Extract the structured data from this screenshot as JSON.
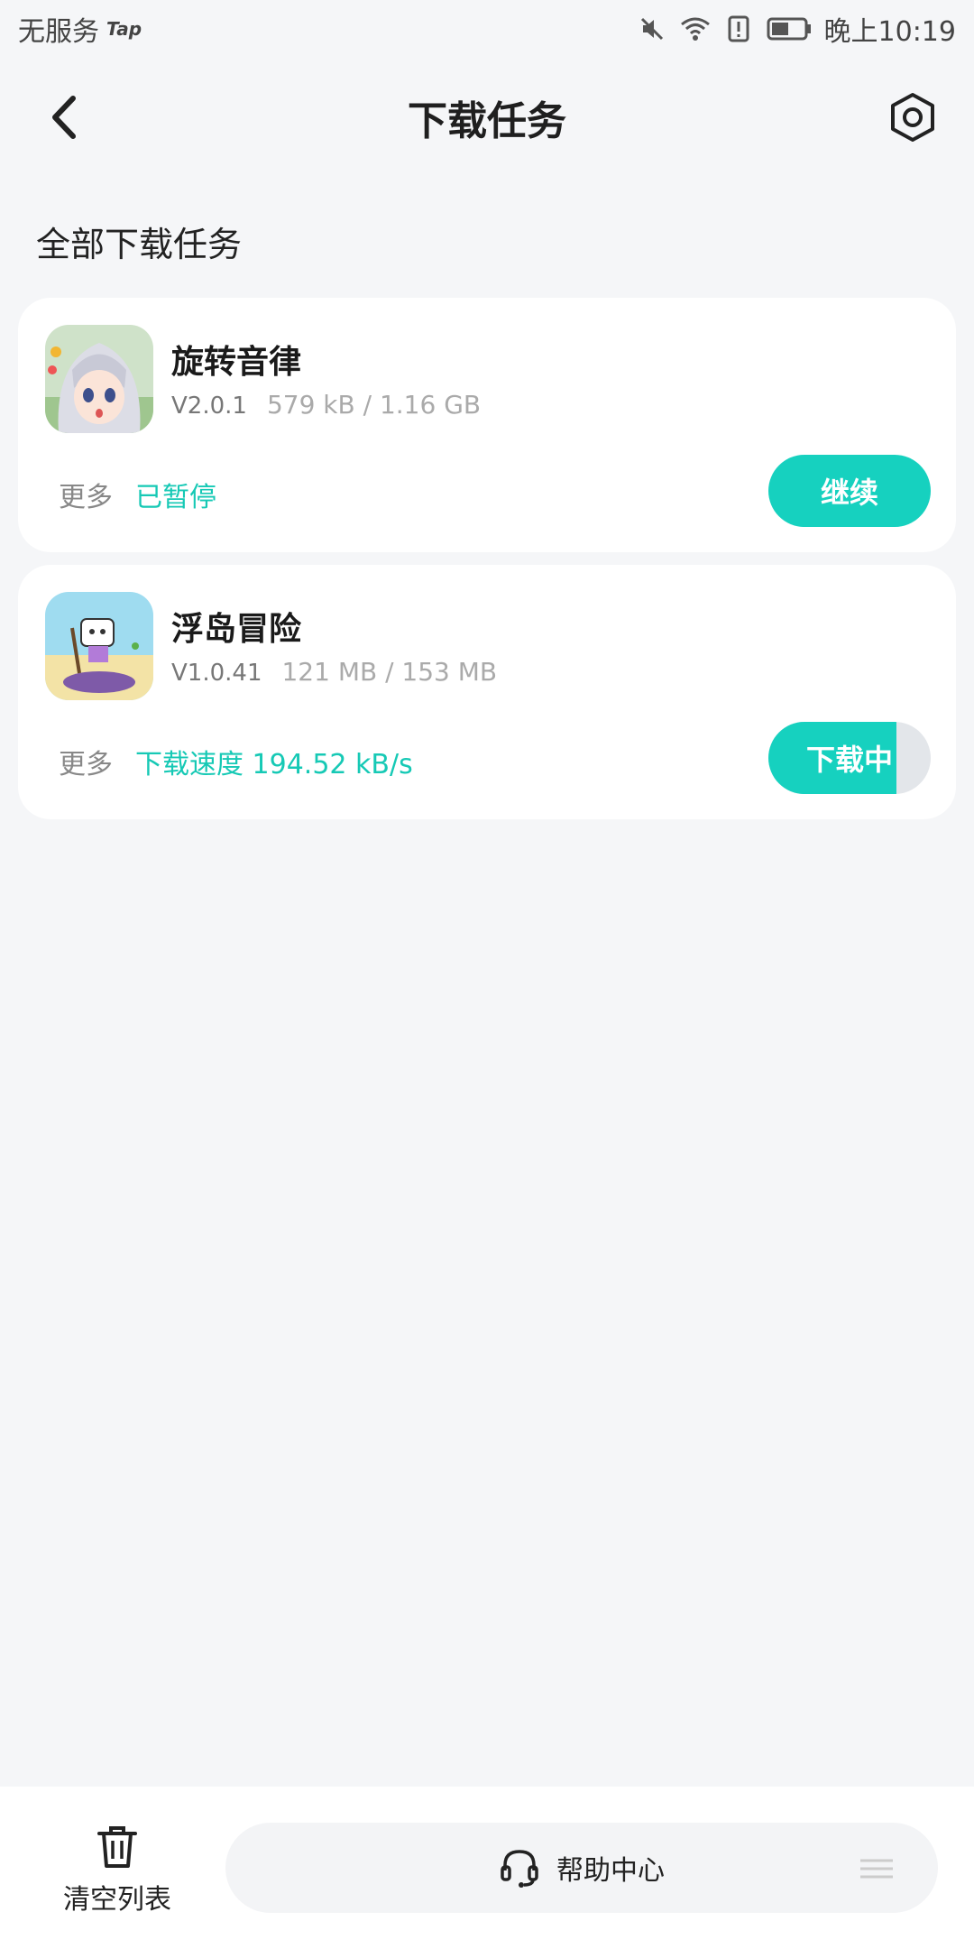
{
  "status_bar": {
    "carrier": "无服务",
    "tap_logo": "Tap",
    "time": "晚上10:19",
    "icons": [
      "mute-icon",
      "wifi-icon",
      "sim-alert-icon",
      "battery-icon"
    ]
  },
  "header": {
    "title": "下载任务",
    "back_icon": "chevron-left-icon",
    "settings_icon": "settings-hexagon-icon"
  },
  "section": {
    "title": "全部下载任务"
  },
  "tasks": [
    {
      "name": "旋转音律",
      "version": "V2.0.1",
      "size": "579 kB / 1.16 GB",
      "more_label": "更多",
      "status_text": "已暂停",
      "button_label": "继续",
      "icon": "anime-character-app-icon"
    },
    {
      "name": "浮岛冒险",
      "version": "V1.0.41",
      "size": "121 MB / 153 MB",
      "more_label": "更多",
      "status_text": "下载速度 194.52 kB/s",
      "button_label": "下载中",
      "progress": 0.79,
      "icon": "island-adventure-app-icon"
    }
  ],
  "bottom_bar": {
    "clear_label": "清空列表",
    "help_label": "帮助中心",
    "icons": [
      "trash-icon",
      "headset-icon",
      "menu-lines-icon"
    ]
  },
  "colors": {
    "accent": "#16d1bf",
    "status_text": "#16c9b5",
    "background": "#f5f6f8"
  }
}
